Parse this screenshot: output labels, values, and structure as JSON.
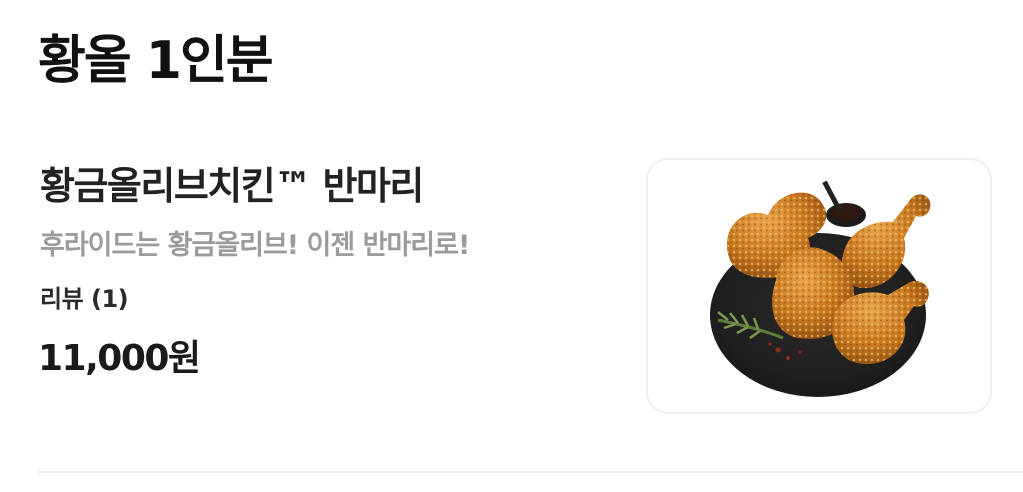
{
  "section": {
    "title": "황올 1인분"
  },
  "menu_item": {
    "name": "황금올리브치킨™ 반마리",
    "description": "후라이드는 황금올리브! 이젠 반마리로!",
    "review_label": "리뷰 (1)",
    "price": "11,000원",
    "image_icon": "fried-chicken-photo"
  },
  "colors": {
    "title": "#111111",
    "description": "#9b9b9b",
    "border": "#eeeeee",
    "chicken": "#c8781f"
  }
}
